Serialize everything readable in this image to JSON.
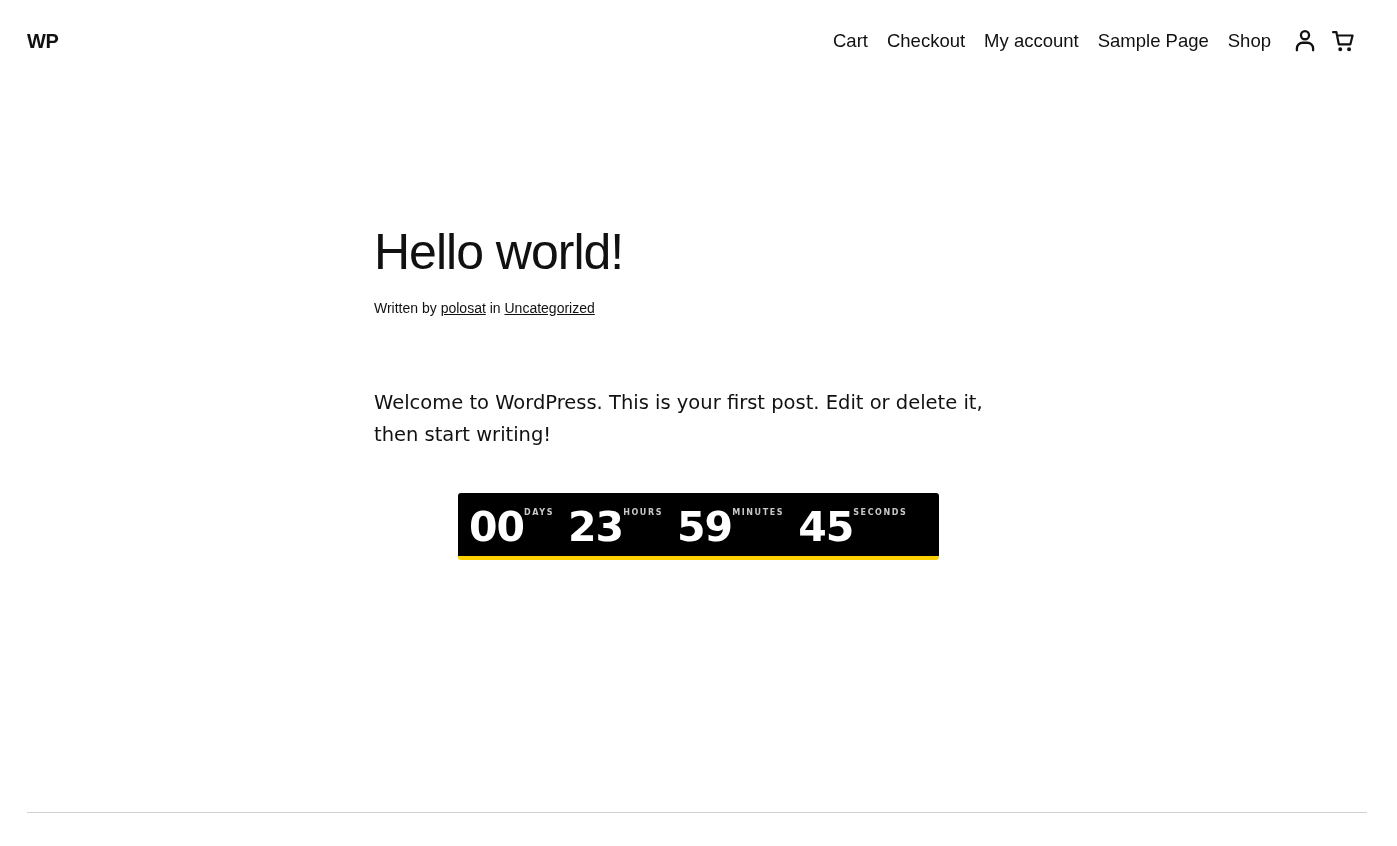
{
  "header": {
    "site_title": "WP",
    "nav": {
      "items": [
        {
          "label": "Cart"
        },
        {
          "label": "Checkout"
        },
        {
          "label": "My account"
        },
        {
          "label": "Sample Page"
        },
        {
          "label": "Shop"
        }
      ],
      "icons": [
        {
          "kind": "account"
        },
        {
          "kind": "cart"
        }
      ]
    }
  },
  "post": {
    "title": "Hello world!",
    "meta": {
      "prefix": "Written by",
      "author": "polosat",
      "connector": "in",
      "category": "Uncategorized"
    },
    "body": "Welcome to WordPress. This is your first post. Edit or delete it, then start writing!"
  },
  "countdown": {
    "units": [
      {
        "value": "00",
        "label": "DAYS"
      },
      {
        "value": "23",
        "label": "HOURS"
      },
      {
        "value": "59",
        "label": "MINUTES"
      },
      {
        "value": "45",
        "label": "SECONDS"
      }
    ]
  }
}
